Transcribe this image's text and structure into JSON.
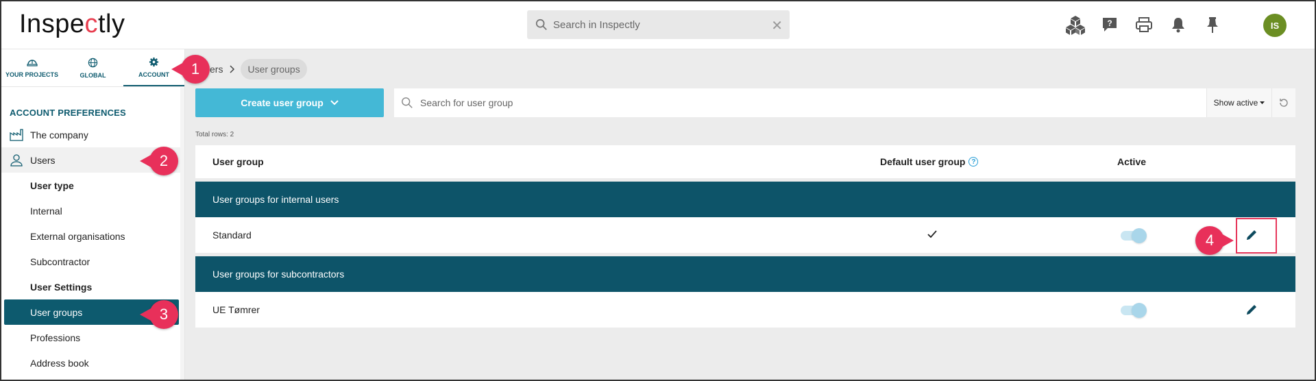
{
  "header": {
    "logo_text_1": "Inspe",
    "logo_text_2": "c",
    "logo_text_3": "tly",
    "search_placeholder": "Search in Inspectly",
    "clear_glyph": "✕",
    "icons": [
      "cubes-icon",
      "help-chat-icon",
      "print-icon",
      "bell-icon",
      "pin-icon"
    ],
    "avatar_initials": "IS",
    "avatar_color": "#6b8e23"
  },
  "sidebar": {
    "tabs": [
      {
        "label": "YOUR PROJECTS",
        "icon": "hardhat-icon"
      },
      {
        "label": "GLOBAL",
        "icon": "globe-icon"
      },
      {
        "label": "ACCOUNT",
        "icon": "gear-icon",
        "active": true
      }
    ],
    "section_title": "ACCOUNT PREFERENCES",
    "items": [
      {
        "label": "The company",
        "icon": "factory-icon"
      },
      {
        "label": "Users",
        "icon": "user-icon"
      },
      {
        "label": "User type"
      },
      {
        "label": "Internal"
      },
      {
        "label": "External organisations"
      },
      {
        "label": "Subcontractor"
      },
      {
        "label": "User Settings"
      },
      {
        "label": "User groups",
        "active": true
      },
      {
        "label": "Professions"
      },
      {
        "label": "Address book"
      }
    ]
  },
  "main": {
    "breadcrumb": {
      "parent": "ers",
      "current": "User groups"
    },
    "create_button": "Create user group",
    "search_placeholder": "Search for user group",
    "show_active": "Show active",
    "total_rows": "Total rows: 2",
    "columns": {
      "group": "User group",
      "default": "Default user group",
      "active": "Active"
    },
    "groups": [
      {
        "title": "User groups for internal users",
        "rows": [
          {
            "name": "Standard",
            "default": true,
            "active": true
          }
        ]
      },
      {
        "title": "User groups for subcontractors",
        "rows": [
          {
            "name": "UE Tømrer",
            "default": false,
            "active": true
          }
        ]
      }
    ]
  },
  "callouts": [
    "1",
    "2",
    "3",
    "4"
  ],
  "colors": {
    "primary": "#0d5a6e",
    "accent_button": "#44b8d6",
    "callout": "#e8305a",
    "group_header": "#0d5469"
  }
}
